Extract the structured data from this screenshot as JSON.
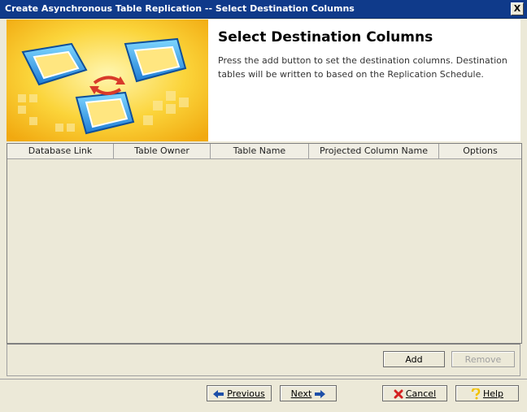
{
  "window": {
    "title": "Create Asynchronous Table Replication -- Select Destination Columns",
    "close_glyph": "X"
  },
  "header": {
    "title": "Select Destination Columns",
    "description": "Press the add button to set the destination columns. Destination tables will be written to based on the Replication Schedule."
  },
  "table": {
    "columns": [
      "Database Link",
      "Table Owner",
      "Table Name",
      "Projected Column Name",
      "Options"
    ],
    "rows": []
  },
  "table_buttons": {
    "add": "Add",
    "remove": "Remove"
  },
  "nav_buttons": {
    "previous": "Previous",
    "next": "Next",
    "cancel": "Cancel",
    "help": "Help"
  },
  "colors": {
    "titlebar": "#0f3a8a",
    "banner_bg": "#f7c21a",
    "cancel_icon": "#d42020",
    "help_icon": "#f2c200",
    "arrow_icon": "#1d4fa8"
  }
}
